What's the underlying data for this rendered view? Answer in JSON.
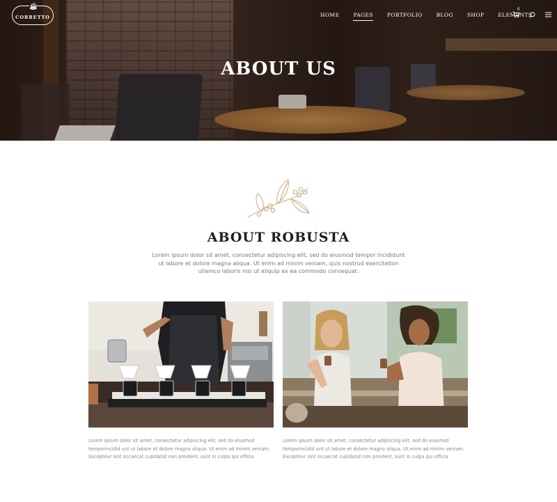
{
  "header": {
    "logo_text": "CORRETTO",
    "nav": [
      "HOME",
      "PAGES",
      "PORTFOLIO",
      "BLOG",
      "SHOP",
      "ELEMENTS"
    ],
    "active_nav": "PAGES",
    "cart_count": "0"
  },
  "hero": {
    "title": "ABOUT US"
  },
  "about": {
    "title": "ABOUT ROBUSTA",
    "text": "Lorem ipsum dolor sit amet, consectetur adipiscing elit, sed do eiusmod tempor incididunt ut labore et dolore magna aliqua. Ut enim ad minim veniam, quis nostrud exercitation ullamco laboris nisi ut aliquip ex ea commodo consequat."
  },
  "cards": [
    {
      "image": "barista pouring coffee over pour-over drippers",
      "caption": "Lorem ipsum dolor sit amet, consectetur adipiscing elit, sed do eiusmod temporincidid unt ut labore et dolore magna aliqua. Ut enim ad minim veniam. Excepteur sint occaecat cupidatat non proident, sunt in culpa qui officia"
    },
    {
      "image": "two women holding coffee cups at a counter",
      "caption": "Lorem ipsum dolor sit amet, consectetur adipiscing elit, sed do eiusmod temporincidid unt ut labore et dolore magna aliqua. Ut enim ad minim veniam. Excepteur sint occaecat cupidatat non proident, sunt in culpa qui officia"
    }
  ],
  "icons": [
    "cart-icon",
    "search-icon",
    "menu-icon",
    "coffee-cup-icon",
    "coffee-sprig-icon"
  ],
  "colors": {
    "accent": "#c8a77c",
    "hero_overlay": "#2a1a14",
    "title_text": "#1e1e1e",
    "body_text": "#777777"
  }
}
